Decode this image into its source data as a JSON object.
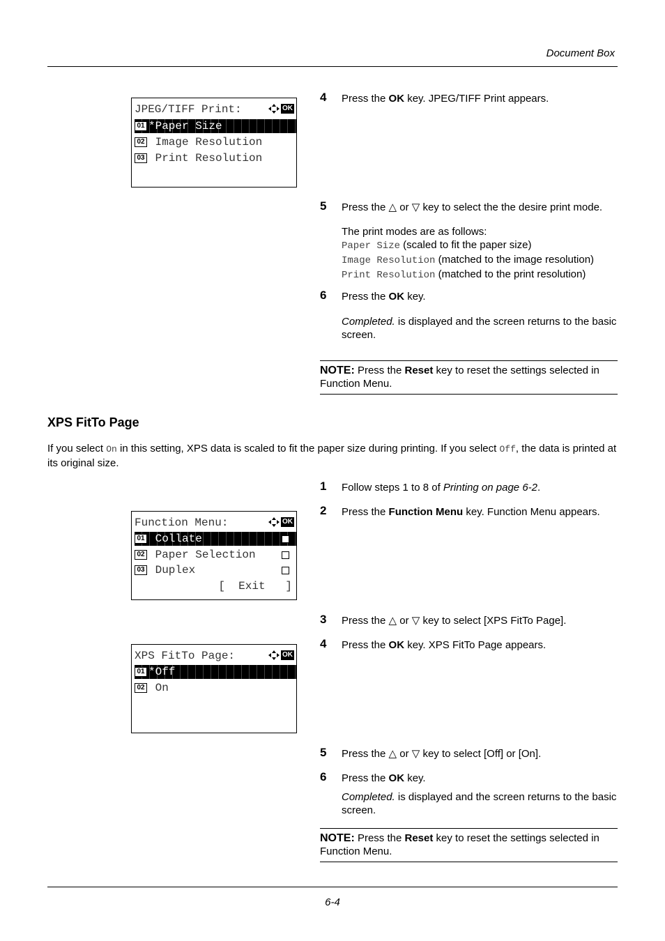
{
  "header": {
    "title": "Document Box"
  },
  "footer": {
    "page": "6-4"
  },
  "jpeg_tiff": {
    "lcd": {
      "title": "JPEG/TIFF Print:",
      "items": [
        {
          "num": "01",
          "label": "*Paper Size",
          "selected": true
        },
        {
          "num": "02",
          "label": " Image Resolution",
          "selected": false
        },
        {
          "num": "03",
          "label": " Print Resolution",
          "selected": false
        }
      ]
    },
    "steps": [
      {
        "num": "4",
        "pre": "Press the ",
        "bold": "OK",
        "post": " key. JPEG/TIFF Print appears."
      },
      {
        "num": "5",
        "text": "Press the △ or ▽ key to select the the desire print mode."
      },
      {
        "num": "6",
        "pre": "Press the ",
        "bold": "OK",
        "post": " key."
      }
    ],
    "modes_intro": "The print modes are as follows:",
    "modes": [
      {
        "code": "Paper Size",
        "desc": " (scaled to fit the paper size)"
      },
      {
        "code": "Image Resolution",
        "desc": " (matched to the image resolution)"
      },
      {
        "code": "Print Resolution",
        "desc": " (matched to the print resolution)"
      }
    ],
    "completed_italic": "Completed.",
    "completed_rest": " is displayed and the screen returns to the basic screen.",
    "note": {
      "label": "NOTE:",
      "pre": " Press the ",
      "bold": "Reset",
      "post": " key to reset the settings selected in Function Menu."
    }
  },
  "xps": {
    "section_title": "XPS FitTo Page",
    "intro": {
      "p1": "If you select ",
      "code1": "On",
      "p2": " in this setting, XPS data is scaled to fit the paper size during printing. If you select ",
      "code2": "Off",
      "p3": ", the data is printed at its original size."
    },
    "step1": {
      "num": "1",
      "pre": "Follow steps 1 to 8 of ",
      "italic": "Printing on page 6-2",
      "post": "."
    },
    "step2": {
      "num": "2",
      "pre": "Press the ",
      "bold": "Function Menu",
      "post": " key. Function Menu appears."
    },
    "step3": {
      "num": "3",
      "text": "Press the △ or ▽ key to select [XPS FitTo Page]."
    },
    "step4": {
      "num": "4",
      "pre": "Press the ",
      "bold": "OK",
      "post": " key. XPS FitTo Page appears."
    },
    "step5": {
      "num": "5",
      "text": "Press the △ or ▽ key to select [Off] or [On]."
    },
    "step6": {
      "num": "6",
      "pre": "Press the ",
      "bold": "OK",
      "post": " key."
    },
    "completed_italic": "Completed.",
    "completed_rest": " is displayed and the screen returns to the basic screen.",
    "note": {
      "label": "NOTE:",
      "pre": " Press the ",
      "bold": "Reset",
      "post": " key to reset the settings selected in Function Menu."
    },
    "function_lcd": {
      "title": "Function Menu:",
      "items": [
        {
          "num": "01",
          "label": " Collate",
          "selected": true
        },
        {
          "num": "02",
          "label": " Paper Selection",
          "selected": false
        },
        {
          "num": "03",
          "label": " Duplex",
          "selected": false
        }
      ],
      "exit": "[  Exit   ]"
    },
    "fitto_lcd": {
      "title": "XPS FitTo Page:",
      "items": [
        {
          "num": "01",
          "label": "*Off",
          "selected": true
        },
        {
          "num": "02",
          "label": " On",
          "selected": false
        }
      ]
    }
  }
}
